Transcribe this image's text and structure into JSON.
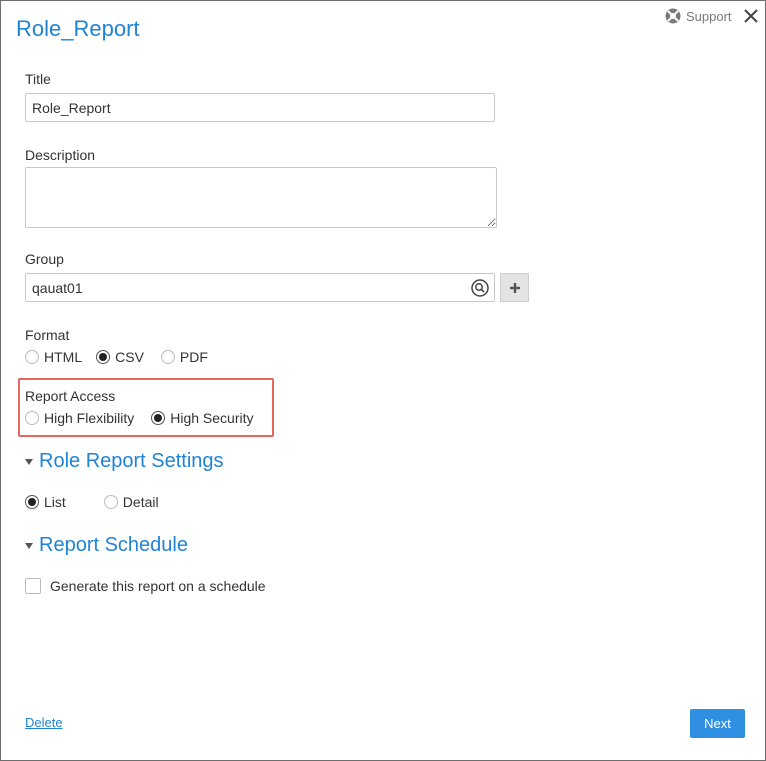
{
  "dialog": {
    "title": "Role_Report",
    "support_label": "Support",
    "support_icon": "lifebuoy-icon",
    "close_icon": "close-icon"
  },
  "form": {
    "title_label": "Title",
    "title_value": "Role_Report",
    "description_label": "Description",
    "description_value": "",
    "group_label": "Group",
    "group_value": "qauat01",
    "format_label": "Format",
    "format_options": [
      {
        "label": "HTML",
        "selected": false
      },
      {
        "label": "CSV",
        "selected": true
      },
      {
        "label": "PDF",
        "selected": false
      }
    ],
    "access_label": "Report Access",
    "access_options": [
      {
        "label": "High Flexibility",
        "selected": false
      },
      {
        "label": "High Security",
        "selected": true
      }
    ]
  },
  "settings": {
    "heading": "Role Report Settings",
    "view_options": [
      {
        "label": "List",
        "selected": true
      },
      {
        "label": "Detail",
        "selected": false
      }
    ]
  },
  "schedule": {
    "heading": "Report Schedule",
    "checkbox_label": "Generate this report on a schedule",
    "checked": false
  },
  "footer": {
    "delete_label": "Delete",
    "next_label": "Next"
  },
  "colors": {
    "accent": "#1f84d6",
    "highlight_border": "#e2685e",
    "primary_button": "#2f8fe3"
  }
}
